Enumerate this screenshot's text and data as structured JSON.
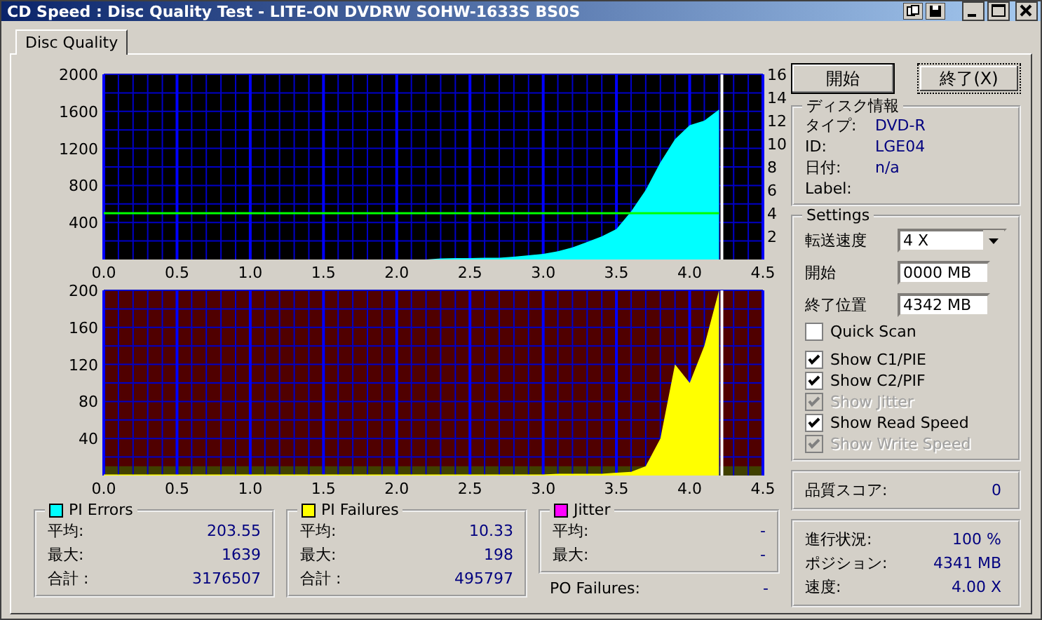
{
  "window": {
    "title": "CD Speed : Disc Quality Test - LITE-ON DVDRW SOHW-1633S BS0S"
  },
  "tabs": [
    {
      "label": "Disc Quality",
      "selected": true
    }
  ],
  "charts": [
    {
      "chart_data": {
        "type": "area",
        "grid": true,
        "xlim": [
          0,
          4.5
        ],
        "ylim": [
          0,
          2000
        ],
        "y2lim": [
          0,
          16
        ],
        "ref_lines": [
          {
            "axis": "x",
            "value": 4.22,
            "color": "#ffffff"
          }
        ],
        "xticks": [
          {
            "value": 0,
            "label": "0.0"
          },
          {
            "value": 0.5,
            "label": "0.5"
          },
          {
            "value": 1,
            "label": "1.0"
          },
          {
            "value": 1.5,
            "label": "1.5"
          },
          {
            "value": 2,
            "label": "2.0"
          },
          {
            "value": 2.5,
            "label": "2.5"
          },
          {
            "value": 3,
            "label": "3.0"
          },
          {
            "value": 3.5,
            "label": "3.5"
          },
          {
            "value": 4,
            "label": "4.0"
          },
          {
            "value": 4.5,
            "label": "4.5"
          }
        ],
        "yticks": [
          400,
          800,
          1200,
          1600,
          2000
        ],
        "y2ticks": [
          2,
          4,
          6,
          8,
          10,
          12,
          14,
          16
        ],
        "x": [
          0,
          0.1,
          0.2,
          0.3,
          0.4,
          0.5,
          0.6,
          0.7,
          0.8,
          0.9,
          1.0,
          1.1,
          1.2,
          1.3,
          1.4,
          1.5,
          1.6,
          1.7,
          1.8,
          1.9,
          2.0,
          2.1,
          2.2,
          2.3,
          2.4,
          2.5,
          2.6,
          2.7,
          2.8,
          2.9,
          3.0,
          3.1,
          3.2,
          3.3,
          3.4,
          3.5,
          3.6,
          3.7,
          3.8,
          3.9,
          4.0,
          4.1,
          4.2
        ],
        "series": [
          {
            "color": "#00ffff",
            "values": [
              0,
              0,
              0,
              0,
              0,
              0,
              0,
              0,
              0,
              0,
              0,
              0,
              0,
              0,
              0,
              0,
              0,
              0,
              0,
              0,
              0,
              0,
              0,
              10,
              15,
              15,
              20,
              20,
              30,
              45,
              60,
              90,
              130,
              190,
              250,
              330,
              520,
              750,
              1050,
              1300,
              1450,
              1500,
              1620
            ]
          },
          {
            "color": "#00ff00",
            "axis": "y2",
            "type": "line",
            "values": [
              4,
              4,
              4,
              4,
              4,
              4,
              4,
              4,
              4,
              4,
              4,
              4,
              4,
              4,
              4,
              4,
              4,
              4,
              4,
              4,
              4,
              4,
              4,
              4,
              4,
              4,
              4,
              4,
              4,
              4,
              4,
              4,
              4,
              4,
              4,
              4,
              4,
              4,
              4,
              4,
              4,
              4,
              4
            ]
          }
        ]
      }
    },
    {
      "chart_data": {
        "type": "area",
        "grid": true,
        "xlim": [
          0,
          4.5
        ],
        "ylim": [
          0,
          200
        ],
        "ref_lines": [
          {
            "axis": "x",
            "value": 4.22,
            "color": "#ffffff"
          }
        ],
        "bands": [
          {
            "axis": "y",
            "from": 0,
            "to": 10,
            "color": "#404000"
          }
        ],
        "xticks": [
          {
            "value": 0,
            "label": "0.0"
          },
          {
            "value": 0.5,
            "label": "0.5"
          },
          {
            "value": 1,
            "label": "1.0"
          },
          {
            "value": 1.5,
            "label": "1.5"
          },
          {
            "value": 2,
            "label": "2.0"
          },
          {
            "value": 2.5,
            "label": "2.5"
          },
          {
            "value": 3,
            "label": "3.0"
          },
          {
            "value": 3.5,
            "label": "3.5"
          },
          {
            "value": 4,
            "label": "4.0"
          },
          {
            "value": 4.5,
            "label": "4.5"
          }
        ],
        "yticks": [
          40,
          80,
          120,
          160,
          200
        ],
        "x": [
          0,
          0.1,
          0.2,
          0.3,
          0.4,
          0.5,
          0.6,
          0.7,
          0.8,
          0.9,
          1.0,
          1.1,
          1.2,
          1.3,
          1.4,
          1.5,
          1.6,
          1.7,
          1.8,
          1.9,
          2.0,
          2.1,
          2.2,
          2.3,
          2.4,
          2.5,
          2.6,
          2.7,
          2.8,
          2.9,
          3.0,
          3.1,
          3.2,
          3.3,
          3.4,
          3.5,
          3.6,
          3.7,
          3.8,
          3.9,
          4.0,
          4.1,
          4.2
        ],
        "series": [
          {
            "color": "#ffff00",
            "values": [
              1,
              1,
              1,
              1,
              1,
              1,
              1,
              1,
              1,
              1,
              1,
              1,
              1,
              1,
              1,
              1,
              1,
              1,
              1,
              1,
              1,
              1,
              1,
              1,
              1,
              1,
              1,
              1,
              1,
              1,
              1,
              2,
              2,
              2,
              2,
              3,
              4,
              10,
              40,
              120,
              100,
              140,
              200
            ]
          }
        ]
      }
    }
  ],
  "stats": [
    {
      "title": "PI Errors",
      "color": "#00ffff",
      "rows": [
        {
          "label": "平均:",
          "value": "203.55"
        },
        {
          "label": "最大:",
          "value": "1639"
        },
        {
          "label": "合計 :",
          "value": "3176507"
        }
      ]
    },
    {
      "title": "PI Failures",
      "color": "#ffff00",
      "rows": [
        {
          "label": "平均:",
          "value": "10.33"
        },
        {
          "label": "最大:",
          "value": "198"
        },
        {
          "label": "合計 :",
          "value": "495797"
        }
      ]
    },
    {
      "title": "Jitter",
      "color": "#ff00ff",
      "rows": [
        {
          "label": "平均:",
          "value": "-"
        },
        {
          "label": "最大:",
          "value": "-"
        }
      ]
    }
  ],
  "po_failures": {
    "label": "PO Failures:",
    "value": "-"
  },
  "buttons": [
    {
      "label": "開始",
      "focused": false
    },
    {
      "label": "終了(X)",
      "focused": true
    }
  ],
  "disc_info": {
    "title": "ディスク情報",
    "rows": [
      {
        "label": "タイプ:",
        "value": "DVD-R"
      },
      {
        "label": "ID:",
        "value": "LGE04"
      },
      {
        "label": "日付:",
        "value": "n/a"
      },
      {
        "label": "Label:"
      }
    ]
  },
  "settings": {
    "title": "Settings",
    "speed": {
      "label": "転送速度",
      "value": "4 X"
    },
    "fields": [
      {
        "label": "開始",
        "value": "0000 MB"
      },
      {
        "label": "終了位置",
        "value": "4342 MB"
      }
    ],
    "checkboxes": [
      {
        "label": "Quick Scan",
        "checked": false,
        "disabled": false
      },
      {
        "label": "Show C1/PIE",
        "checked": true,
        "disabled": false
      },
      {
        "label": "Show C2/PIF",
        "checked": true,
        "disabled": false
      },
      {
        "label": "Show Jitter",
        "checked": true,
        "disabled": true
      },
      {
        "label": "Show Read Speed",
        "checked": true,
        "disabled": false
      },
      {
        "label": "Show Write Speed",
        "checked": true,
        "disabled": true
      }
    ]
  },
  "score": {
    "label": "品質スコア:",
    "value": "0"
  },
  "progress": [
    {
      "label": "進行状況:",
      "value": "100 %"
    },
    {
      "label": "ポジション:",
      "value": "4341 MB"
    },
    {
      "label": "速度:",
      "value": "4.00 X"
    }
  ]
}
